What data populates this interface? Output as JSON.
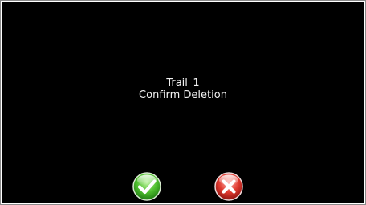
{
  "dialog": {
    "item_name": "Trail_1",
    "prompt": "Confirm Deletion"
  },
  "buttons": {
    "confirm_icon": "check-icon",
    "cancel_icon": "close-icon"
  },
  "colors": {
    "background": "#000000",
    "text": "#f2f2f2",
    "confirm": "#3fae2a",
    "cancel": "#d42a2a"
  }
}
